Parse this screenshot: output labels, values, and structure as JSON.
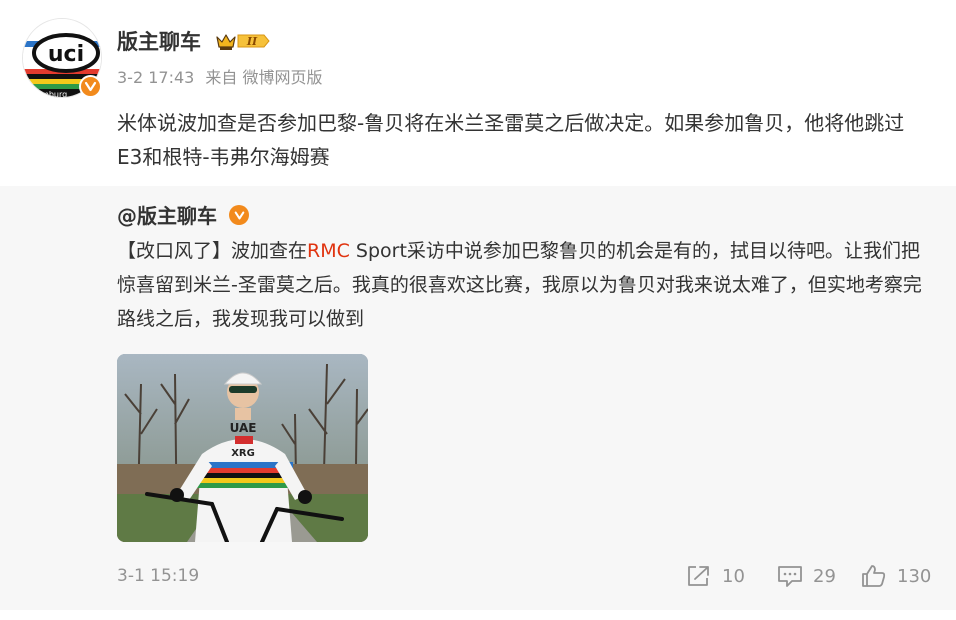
{
  "post": {
    "username": "版主聊车",
    "timestamp": "3-2 17:43",
    "source": "来自 微博网页版",
    "text": "米体说波加查是否参加巴黎-鲁贝将在米兰圣雷莫之后做决定。如果参加鲁贝，他将他跳过E3和根特-韦弗尔海姆赛",
    "level_badge": "II",
    "avatar_text": "uci",
    "avatar_subtext": "imburg"
  },
  "retweet": {
    "author": "@版主聊车",
    "text_part1": "【改口风了】波加查在",
    "text_highlight": "RMC",
    "text_part2": " Sport采访中说参加巴黎鲁贝的机会是有的，拭目以待吧。让我们把惊喜留到米兰-圣雷莫之后。我真的很喜欢这比赛，我原以为鲁贝对我来说太难了，但实地考察完路线之后，我发现我可以做到",
    "timestamp": "3-1 15:19",
    "jersey_text": "UAE",
    "jersey_subtext": "XRG",
    "actions": {
      "share_count": "10",
      "comment_count": "29",
      "like_count": "130"
    }
  },
  "colors": {
    "verify_orange": "#f28a1c",
    "highlight_red": "#e0330f",
    "meta_gray": "#939393",
    "retweet_bg": "#f7f7f7"
  },
  "icons": [
    "uci-avatar",
    "verified-badge-icon",
    "crown-level-icon",
    "share-icon",
    "comment-icon",
    "like-icon"
  ]
}
